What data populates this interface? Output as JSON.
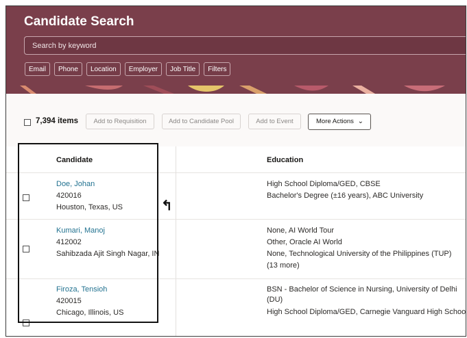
{
  "header": {
    "title": "Candidate Search",
    "search_placeholder": "Search by keyword",
    "filters": [
      "Email",
      "Phone",
      "Location",
      "Employer",
      "Job Title",
      "Filters"
    ]
  },
  "toolbar": {
    "count_label": "7,394 items",
    "add_to_requisition": "Add to Requisition",
    "add_to_candidate_pool": "Add to Candidate Pool",
    "add_to_event": "Add to Event",
    "more_actions": "More Actions"
  },
  "table": {
    "headers": {
      "candidate": "Candidate",
      "education": "Education"
    },
    "rows": [
      {
        "name": "Doe, Johan",
        "id": "420016",
        "location": "Houston, Texas, US",
        "education": [
          "High School Diploma/GED, CBSE",
          "Bachelor's Degree (±16 years), ABC University"
        ]
      },
      {
        "name": "Kumari, Manoj",
        "id": "412002",
        "location": "Sahibzada Ajit Singh Nagar, IN",
        "education": [
          "None, AI World Tour",
          "Other, Oracle AI World",
          "None, Technological University of the Philippines (TUP)",
          "(13 more)"
        ]
      },
      {
        "name": "Firoza, Tensioh",
        "id": "420015",
        "location": "Chicago, Illinois, US",
        "education": [
          "BSN - Bachelor of Science in Nursing, University of Delhi",
          "(DU)",
          "High School Diploma/GED, Carnegie Vanguard High School"
        ]
      }
    ]
  },
  "icons": {
    "chevron": "chevron-down-icon",
    "annotation": "curved-arrow-icon"
  },
  "colors": {
    "header_bg": "#7a3f4b",
    "link": "#227290"
  }
}
